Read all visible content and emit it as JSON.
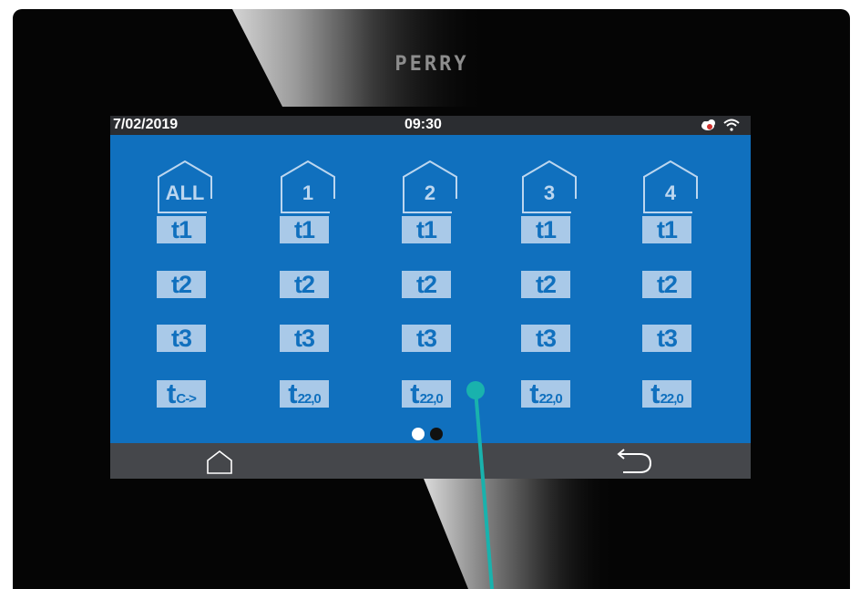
{
  "device": {
    "brand": "PERRY"
  },
  "status_bar": {
    "date": "7/02/2019",
    "time": "09:30",
    "icons": [
      "cloud-alert-icon",
      "wifi-icon"
    ]
  },
  "zones": [
    {
      "label": "ALL",
      "t1": "t1",
      "t2": "t2",
      "t3": "t3",
      "temp_base": "t",
      "temp_sub": "C->"
    },
    {
      "label": "1",
      "t1": "t1",
      "t2": "t2",
      "t3": "t3",
      "temp_base": "t",
      "temp_sub": "22,0"
    },
    {
      "label": "2",
      "t1": "t1",
      "t2": "t2",
      "t3": "t3",
      "temp_base": "t",
      "temp_sub": "22,0"
    },
    {
      "label": "3",
      "t1": "t1",
      "t2": "t2",
      "t3": "t3",
      "temp_base": "t",
      "temp_sub": "22,0"
    },
    {
      "label": "4",
      "t1": "t1",
      "t2": "t2",
      "t3": "t3",
      "temp_base": "t",
      "temp_sub": "22,0"
    }
  ],
  "page_indicator": {
    "total": 2,
    "current": 1
  },
  "nav": {
    "home_icon": "home-icon",
    "back_icon": "back-arrow-icon"
  },
  "colors": {
    "screen_bg": "#1070be",
    "tile_bg": "#a9c9e8",
    "status_bar": "#2b2d31",
    "nav_bar": "#45474b",
    "pointer": "#19b2ad"
  }
}
